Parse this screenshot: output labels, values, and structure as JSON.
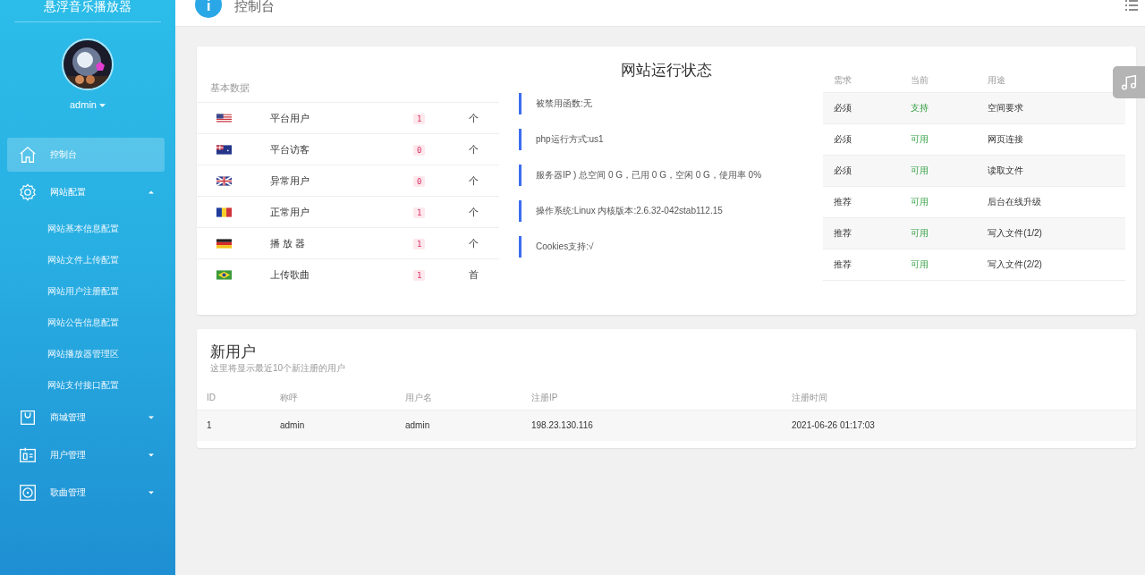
{
  "sidebar": {
    "title": "悬浮音乐播放器",
    "user": "admin",
    "items": [
      {
        "kind": "link",
        "label": "控制台",
        "selected": true
      },
      {
        "kind": "group",
        "label": "网站配置",
        "selected": false,
        "expanded": true,
        "children": [
          {
            "label": "网站基本信息配置"
          },
          {
            "label": "网站文件上传配置"
          },
          {
            "label": "网站用户注册配置"
          },
          {
            "label": "网站公告信息配置"
          },
          {
            "label": "网站播放器管理区"
          },
          {
            "label": "网站支付接口配置"
          }
        ]
      },
      {
        "kind": "group",
        "label": "商城管理",
        "selected": false,
        "expanded": false
      },
      {
        "kind": "group",
        "label": "用户管理",
        "selected": false,
        "expanded": false
      },
      {
        "kind": "group",
        "label": "歌曲管理",
        "selected": false,
        "expanded": false
      }
    ]
  },
  "header": {
    "title": "控制台"
  },
  "status_card": {
    "title": "网站运行状态",
    "basic_label": "基本数据",
    "basic_rows": [
      {
        "label": "平台用户",
        "count": "1",
        "unit": "个"
      },
      {
        "label": "平台访客",
        "count": "0",
        "unit": "个"
      },
      {
        "label": "异常用户",
        "count": "0",
        "unit": "个"
      },
      {
        "label": "正常用户",
        "count": "1",
        "unit": "个"
      },
      {
        "label": "播 放 器",
        "count": "1",
        "unit": "个"
      },
      {
        "label": "上传歌曲",
        "count": "1",
        "unit": "首"
      }
    ],
    "status_items": [
      "被禁用函数:无",
      "php运行方式:us1",
      "服务器IP ) 总空间 0 G，已用 0 G，空闲 0 G，使用率 0%",
      "操作系统:Linux  内核版本:2.6.32-042stab112.15",
      "Cookies支持:√"
    ],
    "env_columns": [
      "需求",
      "当前",
      "用途"
    ],
    "env_rows": [
      {
        "need": "必须",
        "current": "支持",
        "use": "空间要求"
      },
      {
        "need": "必须",
        "current": "可用",
        "use": "网页连接"
      },
      {
        "need": "必须",
        "current": "可用",
        "use": "读取文件"
      },
      {
        "need": "推荐",
        "current": "可用",
        "use": "后台在线升级"
      },
      {
        "need": "推荐",
        "current": "可用",
        "use": "写入文件(1/2)"
      },
      {
        "need": "推荐",
        "current": "可用",
        "use": "写入文件(2/2)"
      }
    ]
  },
  "users_card": {
    "title": "新用户",
    "subtitle": "这里将显示最近10个新注册的用户",
    "columns": [
      "ID",
      "称呼",
      "用户名",
      "注册IP",
      "注册时间"
    ],
    "rows": [
      [
        "1",
        "admin",
        "admin",
        "198.23.130.116",
        "2021-06-26 01:17:03"
      ]
    ]
  }
}
